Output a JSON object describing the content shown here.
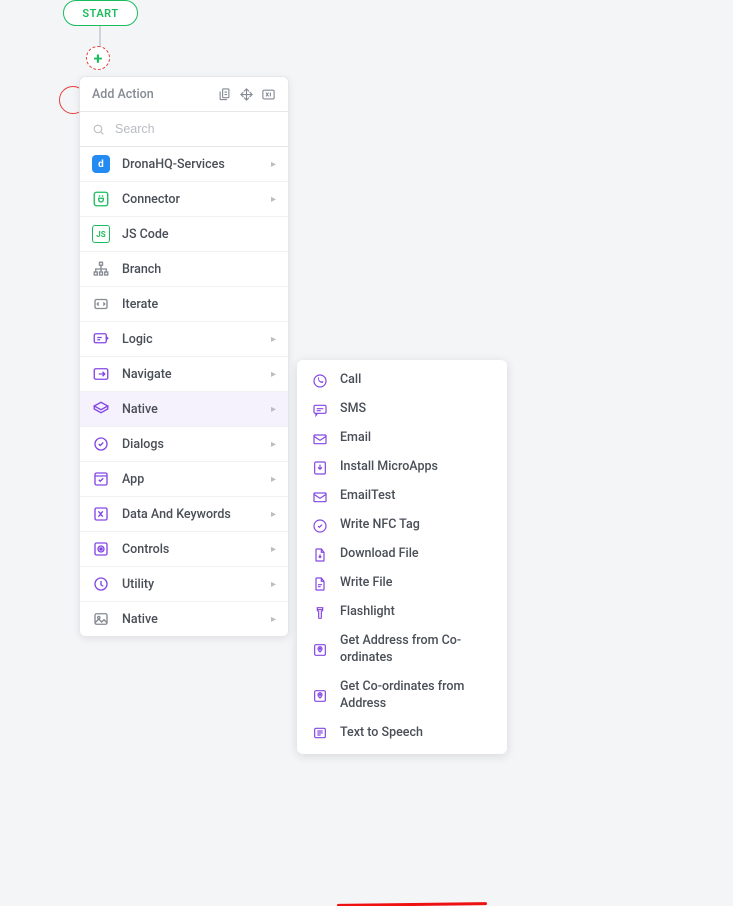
{
  "start": {
    "label": "START"
  },
  "plus": {
    "glyph": "+"
  },
  "dropdown": {
    "title": "Add Action",
    "search": {
      "placeholder": "Search",
      "value": ""
    },
    "items": [
      {
        "label": "DronaHQ-Services",
        "has_children": true
      },
      {
        "label": "Connector",
        "has_children": true
      },
      {
        "label": "JS Code",
        "has_children": false
      },
      {
        "label": "Branch",
        "has_children": false
      },
      {
        "label": "Iterate",
        "has_children": false
      },
      {
        "label": "Logic",
        "has_children": true
      },
      {
        "label": "Navigate",
        "has_children": true
      },
      {
        "label": "Native",
        "has_children": true,
        "selected": true
      },
      {
        "label": "Dialogs",
        "has_children": true
      },
      {
        "label": "App",
        "has_children": true
      },
      {
        "label": "Data And Keywords",
        "has_children": true
      },
      {
        "label": "Controls",
        "has_children": true
      },
      {
        "label": "Utility",
        "has_children": true
      },
      {
        "label": "Native",
        "has_children": true
      }
    ]
  },
  "submenu": {
    "items": [
      {
        "label": "Call"
      },
      {
        "label": "SMS"
      },
      {
        "label": "Email"
      },
      {
        "label": "Install MicroApps"
      },
      {
        "label": "EmailTest"
      },
      {
        "label": "Write NFC Tag"
      },
      {
        "label": "Download File"
      },
      {
        "label": "Write File"
      },
      {
        "label": "Flashlight"
      },
      {
        "label": "Get Address from Co-ordinates",
        "highlighted": true
      },
      {
        "label": "Get Co-ordinates from Address"
      },
      {
        "label": "Text to Speech"
      }
    ]
  },
  "colors": {
    "purple": "#8347e5",
    "green": "#1abc5d",
    "gray": "#858a93",
    "blue": "#248bf2"
  }
}
